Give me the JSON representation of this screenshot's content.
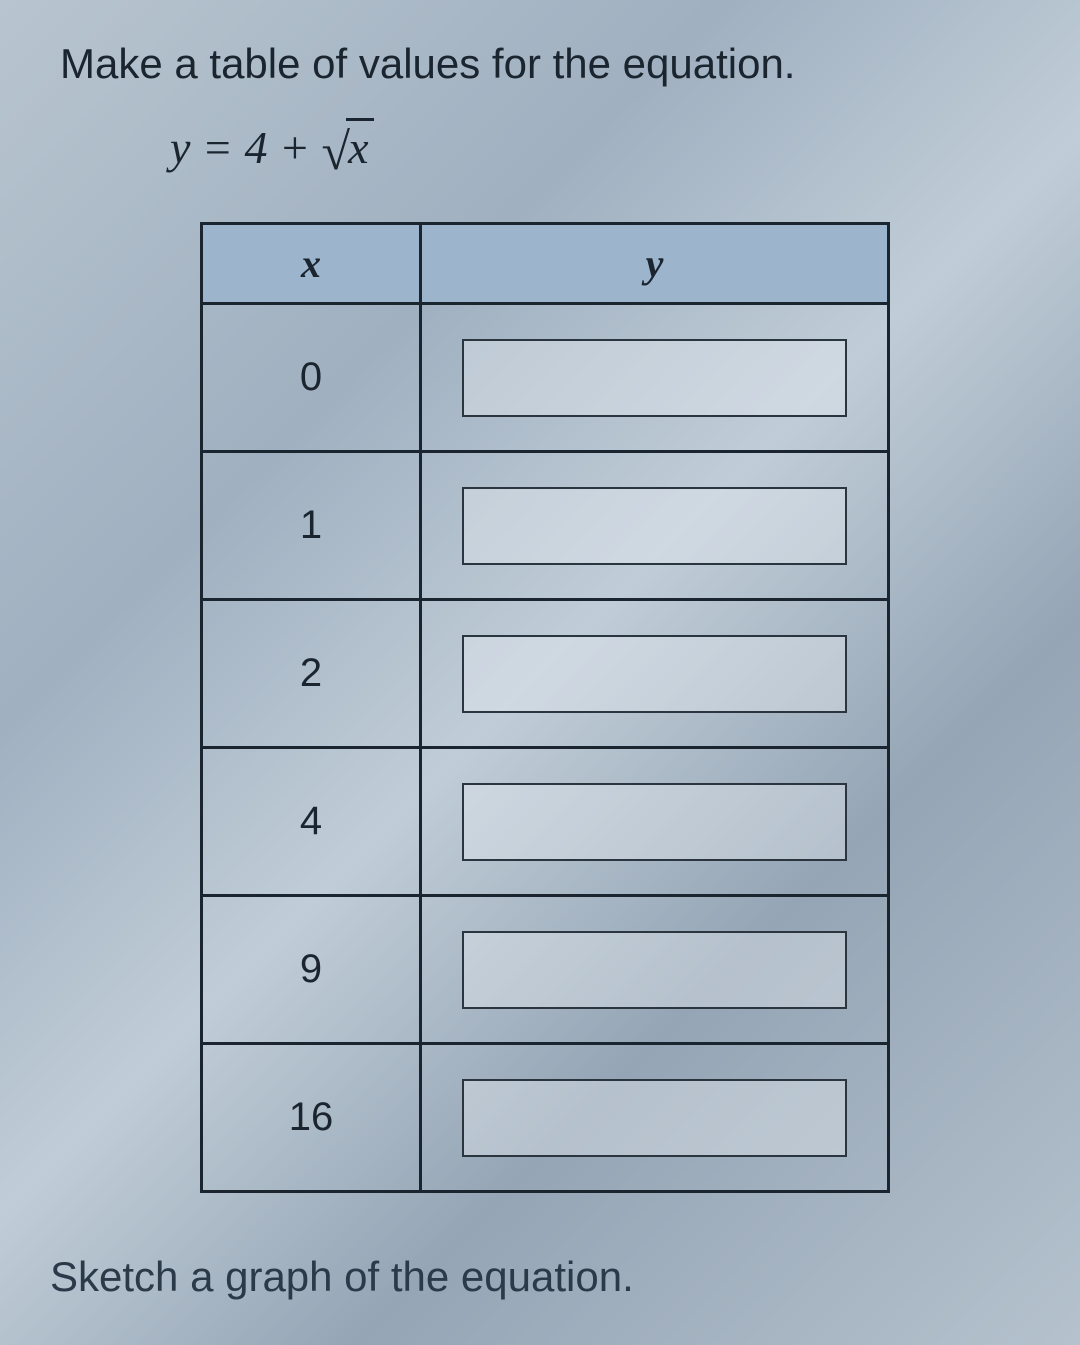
{
  "instruction_top": "Make a table of values for the equation.",
  "equation": {
    "lhs": "y",
    "eq": " = ",
    "constant": "4",
    "op": " + ",
    "radicand": "x"
  },
  "table": {
    "headers": {
      "x": "x",
      "y": "y"
    },
    "rows": [
      {
        "x": "0",
        "y": ""
      },
      {
        "x": "1",
        "y": ""
      },
      {
        "x": "2",
        "y": ""
      },
      {
        "x": "4",
        "y": ""
      },
      {
        "x": "9",
        "y": ""
      },
      {
        "x": "16",
        "y": ""
      }
    ]
  },
  "instruction_bottom": "Sketch a graph of the equation."
}
